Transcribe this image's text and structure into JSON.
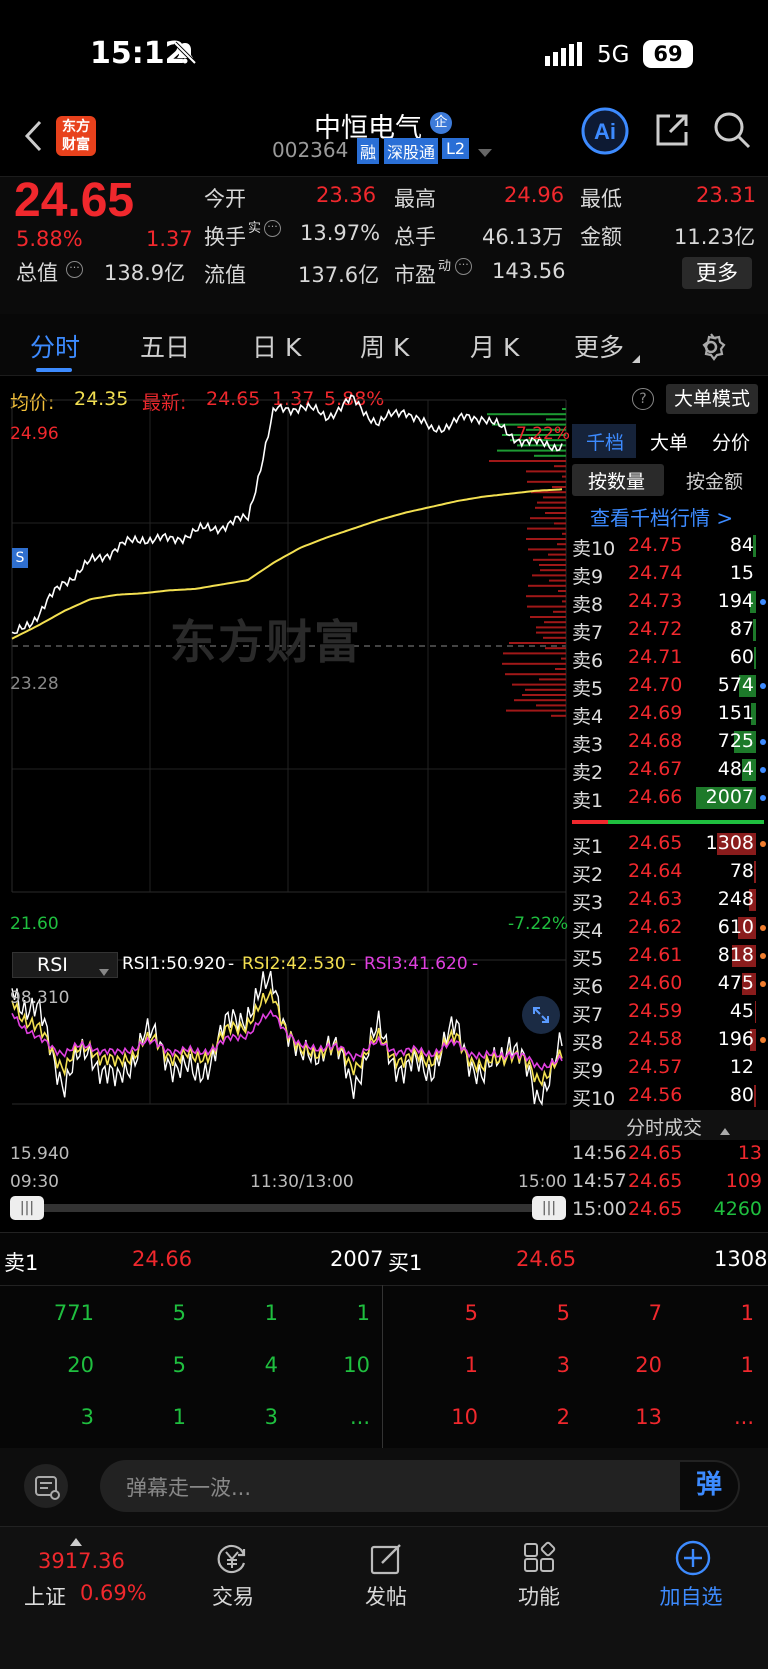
{
  "status_bar": {
    "time": "15:12",
    "network": "5G",
    "battery": "69"
  },
  "header": {
    "logo_text_line1": "东方",
    "logo_text_line2": "财富",
    "stock_name": "中恒电气",
    "enterprise_badge": "企",
    "stock_code": "002364",
    "tags": [
      "融",
      "深股通",
      "L2"
    ]
  },
  "quote": {
    "price": "24.65",
    "change_pct": "5.88%",
    "change": "1.37",
    "total_value_label": "总值",
    "total_value": "138.9亿",
    "float_value_label": "流值",
    "float_value": "137.6亿",
    "pe_label": "市盈",
    "pe_sup": "动",
    "pe": "143.56",
    "open_label": "今开",
    "open": "23.36",
    "high_label": "最高",
    "high": "24.96",
    "low_label": "最低",
    "low": "23.31",
    "turnover_label": "换手",
    "turnover_sup": "实",
    "turnover": "13.97%",
    "volume_label": "总手",
    "volume": "46.13万",
    "amount_label": "金额",
    "amount": "11.23亿",
    "more_button": "更多"
  },
  "tabs": [
    {
      "label": "分时",
      "active": true
    },
    {
      "label": "五日"
    },
    {
      "label": "日 K"
    },
    {
      "label": "周 K"
    },
    {
      "label": "月 K"
    },
    {
      "label": "更多"
    }
  ],
  "info_line": {
    "avg_label": "均价:",
    "avg": "24.35",
    "latest_label": "最新:",
    "latest": "24.65",
    "change": "1.37",
    "change_pct": "5.88%",
    "big_order_mode": "大单模式"
  },
  "chart_labels": {
    "top_price": "24.96",
    "mid_price": "23.28",
    "bottom_price": "21.60",
    "top_pct": "7.22%",
    "bottom_pct": "-7.22%",
    "watermark": "东方财富",
    "s_marker": "S"
  },
  "rsi": {
    "selector": "RSI",
    "rsi1": "RSI1:50.920",
    "rsi2": "RSI2:42.530",
    "rsi3": "RSI3:41.620",
    "dash1": "-",
    "dash2": "-",
    "dash3": "-",
    "top": "98.310",
    "bottom": "15.940"
  },
  "time_axis": {
    "start": "09:30",
    "mid": "11:30/13:00",
    "end": "15:00"
  },
  "chart_data": {
    "type": "line",
    "title": "",
    "x": [
      "09:30",
      "11:30/13:00",
      "15:00"
    ],
    "ylim": [
      21.6,
      24.96
    ],
    "prev_close": 23.28,
    "series": [
      {
        "name": "价格",
        "values": [
          23.33,
          23.5,
          23.72,
          23.85,
          23.95,
          24.02,
          24.0,
          24.06,
          24.1,
          24.15,
          24.88,
          24.92,
          24.85,
          24.96,
          24.8,
          24.9,
          24.75,
          24.82,
          24.85,
          24.72,
          24.66,
          24.65
        ]
      },
      {
        "name": "均价",
        "values": [
          23.33,
          23.42,
          23.52,
          23.6,
          23.63,
          23.64,
          23.66,
          23.67,
          23.7,
          23.73,
          23.85,
          23.95,
          24.02,
          24.08,
          24.14,
          24.19,
          24.23,
          24.27,
          24.3,
          24.32,
          24.34,
          24.35
        ]
      }
    ],
    "rsi_ylim": [
      15.94,
      98.31
    ],
    "rsi_series": [
      {
        "name": "RSI1",
        "values": [
          88,
          70,
          30,
          50,
          25,
          60,
          45,
          30,
          58,
          75,
          90,
          40,
          55,
          30,
          60,
          35,
          40,
          62,
          28,
          58,
          20,
          50
        ]
      },
      {
        "name": "RSI2",
        "values": [
          80,
          60,
          40,
          52,
          38,
          55,
          48,
          42,
          56,
          68,
          82,
          45,
          52,
          40,
          55,
          42,
          45,
          56,
          36,
          50,
          32,
          43
        ]
      },
      {
        "name": "RSI3",
        "values": [
          72,
          55,
          48,
          52,
          46,
          54,
          50,
          47,
          53,
          60,
          72,
          50,
          52,
          46,
          53,
          48,
          48,
          53,
          44,
          48,
          40,
          42
        ]
      }
    ]
  },
  "right_panel": {
    "tabs": [
      "千档",
      "大单",
      "分价"
    ],
    "subtabs": [
      "按数量",
      "按金额"
    ],
    "link": "查看千档行情 >",
    "asks": [
      {
        "label": "卖10",
        "price": "24.75",
        "vol": "84"
      },
      {
        "label": "卖9",
        "price": "24.74",
        "vol": "15"
      },
      {
        "label": "卖8",
        "price": "24.73",
        "vol": "194"
      },
      {
        "label": "卖7",
        "price": "24.72",
        "vol": "87"
      },
      {
        "label": "卖6",
        "price": "24.71",
        "vol": "60"
      },
      {
        "label": "卖5",
        "price": "24.70",
        "vol": "574"
      },
      {
        "label": "卖4",
        "price": "24.69",
        "vol": "151"
      },
      {
        "label": "卖3",
        "price": "24.68",
        "vol": "725"
      },
      {
        "label": "卖2",
        "price": "24.67",
        "vol": "484"
      },
      {
        "label": "卖1",
        "price": "24.66",
        "vol": "2007"
      }
    ],
    "bids": [
      {
        "label": "买1",
        "price": "24.65",
        "vol": "1308"
      },
      {
        "label": "买2",
        "price": "24.64",
        "vol": "78"
      },
      {
        "label": "买3",
        "price": "24.63",
        "vol": "248"
      },
      {
        "label": "买4",
        "price": "24.62",
        "vol": "610"
      },
      {
        "label": "买5",
        "price": "24.61",
        "vol": "818"
      },
      {
        "label": "买6",
        "price": "24.60",
        "vol": "475"
      },
      {
        "label": "买7",
        "price": "24.59",
        "vol": "45"
      },
      {
        "label": "买8",
        "price": "24.58",
        "vol": "196"
      },
      {
        "label": "买9",
        "price": "24.57",
        "vol": "12"
      },
      {
        "label": "买10",
        "price": "24.56",
        "vol": "80"
      }
    ],
    "trades_title": "分时成交",
    "trades": [
      {
        "time": "14:56",
        "price": "24.65",
        "vol": "13"
      },
      {
        "time": "14:57",
        "price": "24.65",
        "vol": "109"
      },
      {
        "time": "15:00",
        "price": "24.65",
        "vol": "4260"
      }
    ]
  },
  "depth": {
    "ask_label": "卖1",
    "ask_price": "24.66",
    "ask_vol": "2007",
    "bid_label": "买1",
    "bid_price": "24.65",
    "bid_vol": "1308",
    "ask_orders": [
      [
        "771",
        "5",
        "1",
        "1"
      ],
      [
        "20",
        "5",
        "4",
        "10"
      ],
      [
        "3",
        "1",
        "3",
        "..."
      ]
    ],
    "bid_orders": [
      [
        "5",
        "5",
        "7",
        "1"
      ],
      [
        "1",
        "3",
        "20",
        "1"
      ],
      [
        "10",
        "2",
        "13",
        "..."
      ]
    ]
  },
  "danmu": {
    "placeholder": "弹幕走一波...",
    "button": "弹"
  },
  "bottom_nav": {
    "index_value": "3917.36",
    "index_name": "上证",
    "index_change": "0.69%",
    "items": [
      {
        "label": "交易"
      },
      {
        "label": "发帖"
      },
      {
        "label": "功能"
      },
      {
        "label": "加自选"
      }
    ]
  },
  "colors": {
    "up": "#f0282d",
    "down": "#1fbf3f",
    "avg_line": "#f3e051",
    "rsi3": "#e040e0",
    "accent": "#3d8bff"
  }
}
